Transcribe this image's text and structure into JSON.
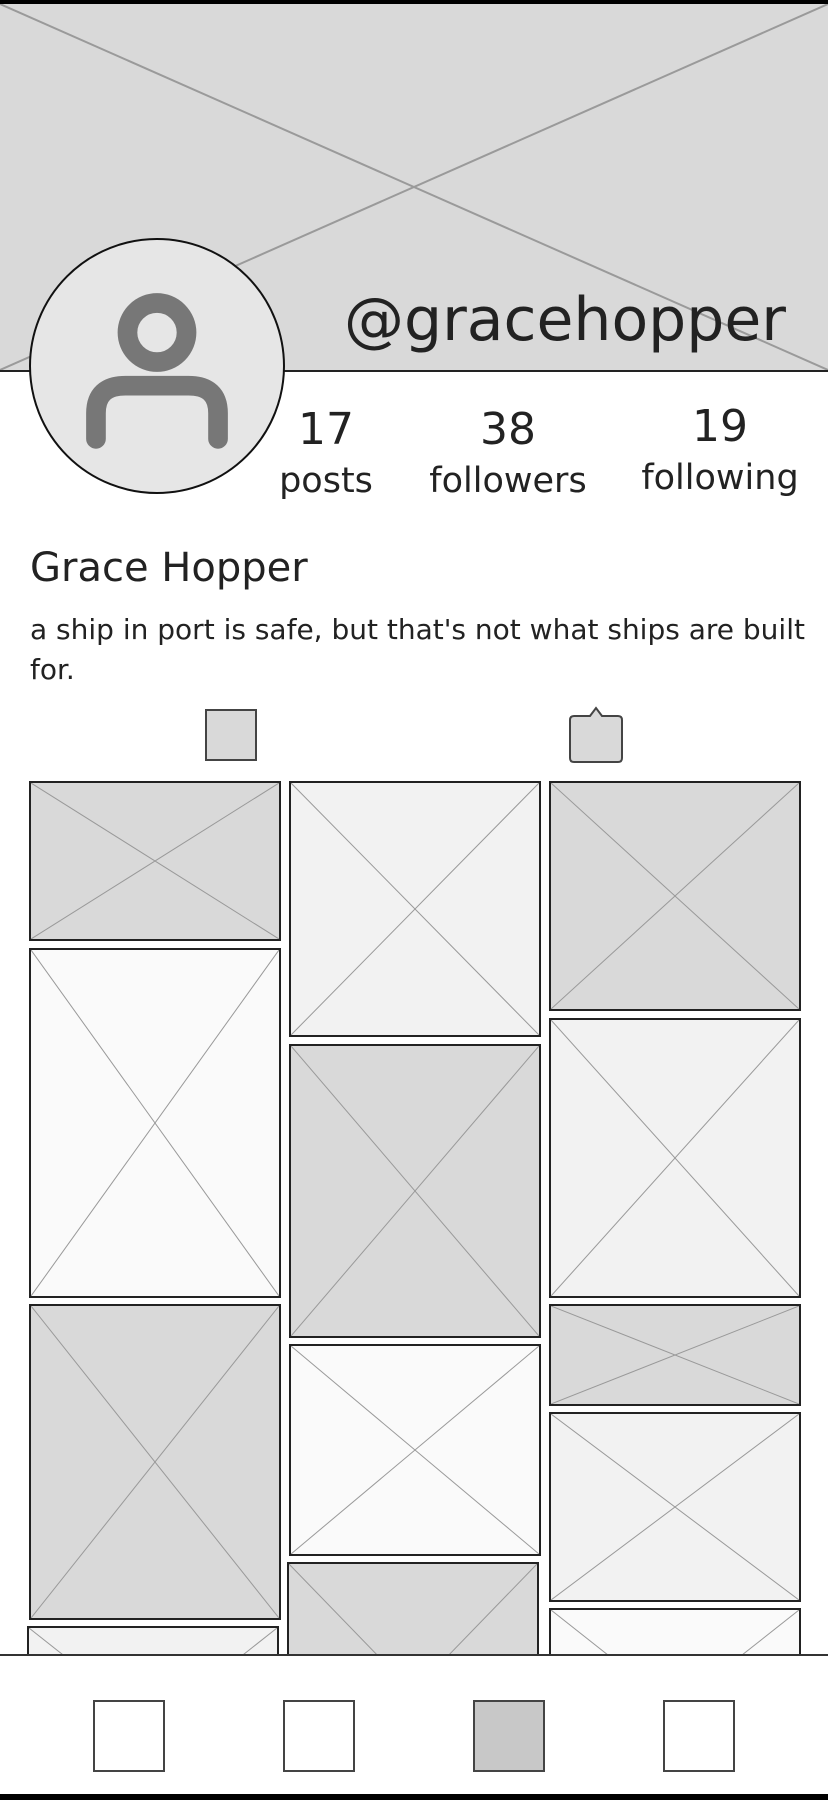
{
  "profile": {
    "username": "@gracehopper",
    "display_name": "Grace Hopper",
    "bio": "a ship in port is safe, but that's not what ships are built for."
  },
  "stats": {
    "posts": {
      "value": "17",
      "label": "posts"
    },
    "followers": {
      "value": "38",
      "label": "followers"
    },
    "following": {
      "value": "19",
      "label": "following"
    }
  },
  "icons": {
    "cover": "image-placeholder",
    "avatar": "person-icon",
    "tab_grid": "grid-view-icon",
    "tab_tagged": "tagged-icon",
    "nav_items": [
      "home-icon",
      "search-icon",
      "profile-icon",
      "settings-icon"
    ]
  },
  "nav": {
    "active_index": 2
  },
  "colors": {
    "placeholder_gray": "#d9d9d9",
    "placeholder_light": "#f2f2f2",
    "placeholder_white": "#fafafa",
    "active_nav": "#c8c8c8",
    "icon_gray": "#777777",
    "text": "#222222"
  }
}
